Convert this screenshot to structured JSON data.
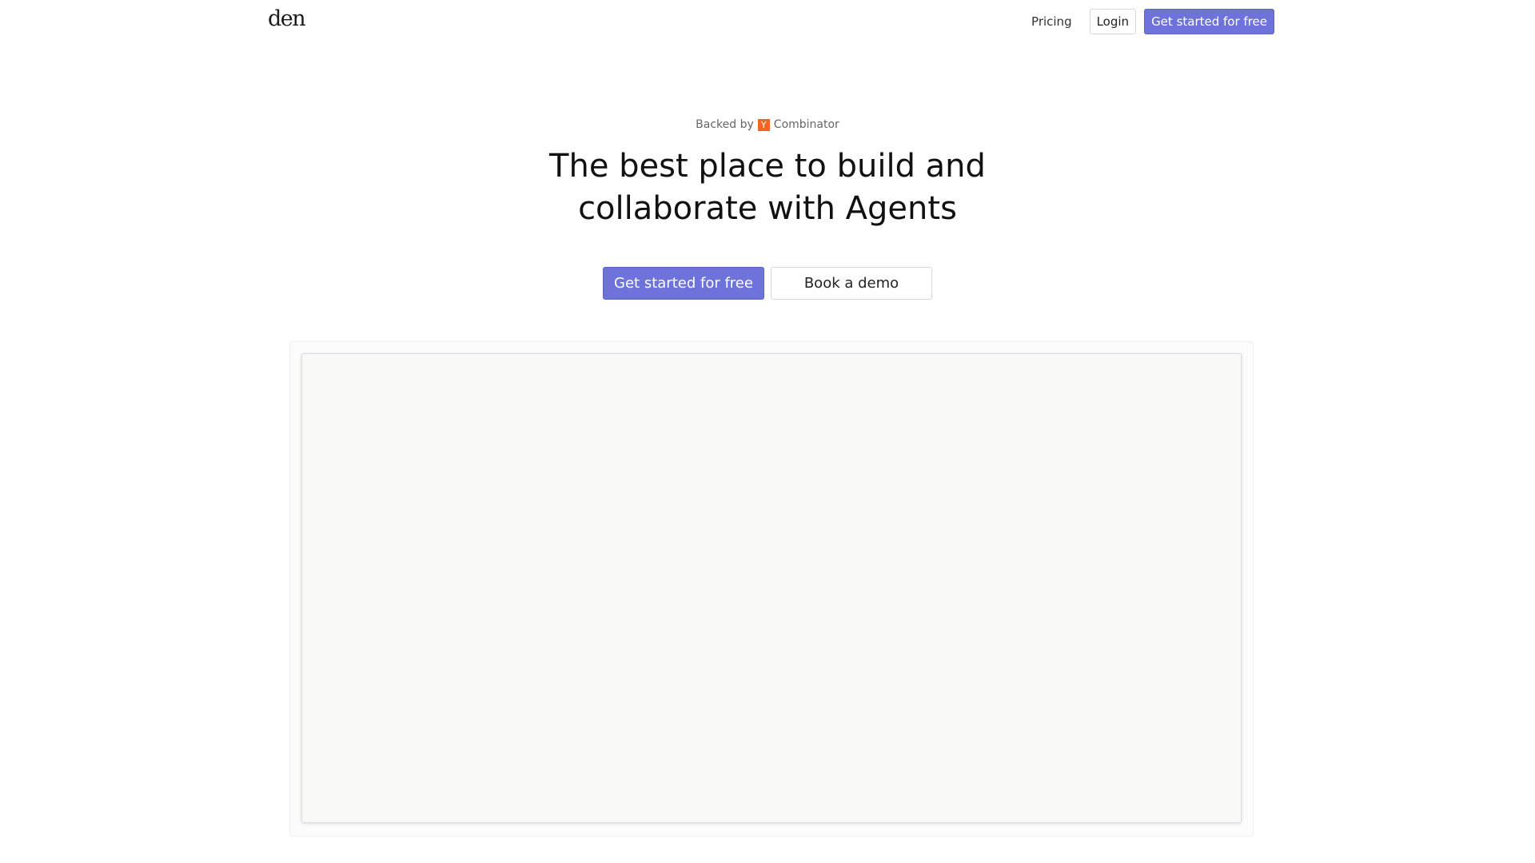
{
  "nav": {
    "logo": "den",
    "pricing": "Pricing",
    "login": "Login",
    "get_started": "Get started for free"
  },
  "hero": {
    "backed_prefix": "Backed by",
    "yc_letter": "Y",
    "backed_suffix": "Combinator",
    "headline": "The best place to build and collaborate with Agents",
    "cta_primary": "Get started for free",
    "cta_secondary": "Book a demo"
  },
  "colors": {
    "accent": "#6e73da",
    "yc_orange": "#f26522"
  }
}
